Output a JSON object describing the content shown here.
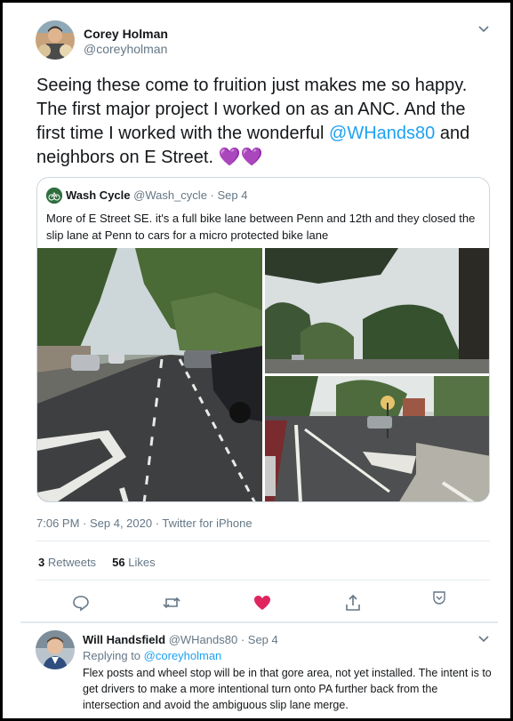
{
  "tweet": {
    "author_name": "Corey Holman",
    "author_handle": "@coreyholman",
    "text_line1": "Seeing these come to fruition just makes me so happy.",
    "text_line2": "The first major project I worked on as an ANC. And the",
    "text_line3_prefix": "first time I worked with the wonderful ",
    "text_line3_mention": "@WHands80",
    "text_line3_suffix": " and",
    "text_line4": "neighbors on E Street. ",
    "hearts": "💜💜",
    "timestamp": "7:06 PM · Sep 4, 2020 · Twitter for iPhone",
    "retweets_count": "3",
    "retweets_label": "Retweets",
    "likes_count": "56",
    "likes_label": "Likes"
  },
  "quote": {
    "author_name": "Wash Cycle",
    "author_handle": "@Wash_cycle",
    "date": "· Sep 4",
    "text": "More of E Street SE. it's a full bike lane between Penn and 12th and they closed the slip lane at Penn to cars for a micro protected bike lane"
  },
  "reply": {
    "author_name": "Will Handsfield",
    "author_handle": "@WHands80",
    "date": "· Sep 4",
    "replying_prefix": "Replying to ",
    "replying_handle": "@coreyholman",
    "text": "Flex posts and wheel stop will be in that gore area, not yet installed.  The intent is to get drivers to make a more intentional turn onto PA further back from the intersection and avoid the ambiguous slip lane merge."
  },
  "colors": {
    "accent": "#1da1f2",
    "like_active": "#e0245e",
    "muted": "#657786"
  },
  "icons": [
    "chevron-down-icon",
    "reply-icon",
    "retweet-icon",
    "heart-icon",
    "share-icon",
    "bookmark-icon"
  ]
}
